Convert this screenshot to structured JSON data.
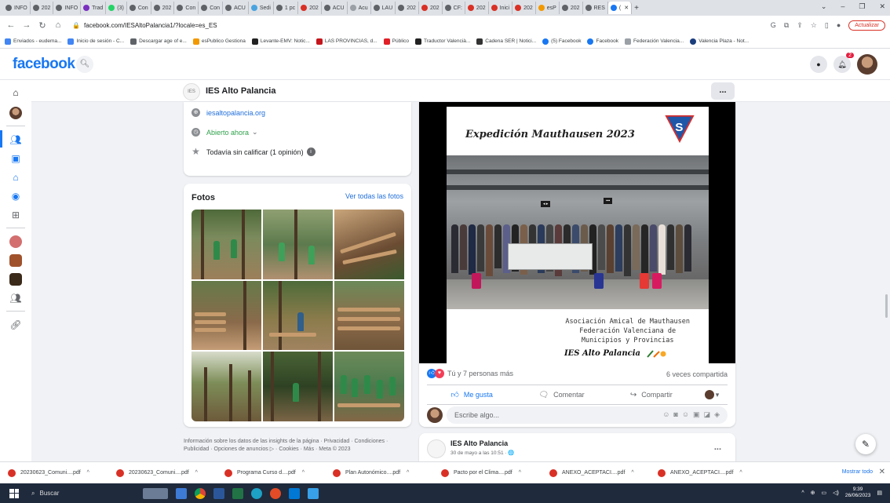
{
  "browser": {
    "tabs": [
      "INFO",
      "202",
      "INFO",
      "Trad",
      "(3)",
      "Con",
      "202",
      "Con",
      "Con",
      "ACU",
      "Sedi",
      "1 pc",
      "202",
      "ACU",
      "Acu",
      "LAU",
      "202",
      "202",
      "CF:",
      "202",
      "Inici",
      "202",
      "esP",
      "202",
      "RES"
    ],
    "active_tab": "(",
    "new_tab_icon": "+",
    "url": "facebook.com/IESAltoPalancia1/?locale=es_ES",
    "update_button": "Actualizar",
    "bookmarks": [
      "Enviados - eudema...",
      "Inicio de sesión - C...",
      "Descargar age of e...",
      "esPublico Gestiona",
      "Levante-EMV: Notic...",
      "LAS PROVINCIAS, d...",
      "Público",
      "Traductor Valencià...",
      "Cadena SER | Notici...",
      "(5) Facebook",
      "Facebook",
      "Federación Valencia...",
      "Valencia Plaza - Not..."
    ]
  },
  "fb": {
    "logo": "facebook",
    "notification_count": "2"
  },
  "page": {
    "name": "IES Alto Palancia",
    "more": "...",
    "website": "iesaltopalancia.org",
    "open_status": "Abierto ahora",
    "rating": "Todavía sin calificar (1 opinión)"
  },
  "photos": {
    "title": "Fotos",
    "see_all": "Ver todas las fotos"
  },
  "footer": {
    "line1": "Información sobre los datos de las insights de la página · Privacidad · Condiciones ·",
    "line2": "Publicidad · Opciones de anuncios ▷ · Cookies · Más · Meta © 2023"
  },
  "post": {
    "poster_title": "Expedición Mauthausen 2023",
    "poster_lines": [
      "Asociación Amical de Mauthausen",
      "Federación Valenciana de",
      "Municipios y Provincias"
    ],
    "poster_signature": "IES Alto Palancia",
    "reactions_text": "Tú y 7 personas más",
    "shares_text": "6 veces compartida",
    "like_label": "Me gusta",
    "comment_label": "Comentar",
    "share_label": "Compartir",
    "comment_placeholder": "Escribe algo..."
  },
  "post2": {
    "name": "IES Alto Palancia",
    "date": "30 de mayo a las 10:51 · 🌐",
    "more": "..."
  },
  "downloads": {
    "items": [
      "20230623_Comuni....pdf",
      "20230623_Comuni....pdf",
      "Programa Curso d....pdf",
      "Plan Autonómico....pdf",
      "Pacto por el Clima....pdf",
      "ANEXO_ACEPTACI....pdf",
      "ANEXO_ACEPTACI....pdf"
    ],
    "show_all": "Mostrar todo"
  },
  "taskbar": {
    "search": "Buscar",
    "time": "9:39",
    "date": "26/06/2023"
  }
}
